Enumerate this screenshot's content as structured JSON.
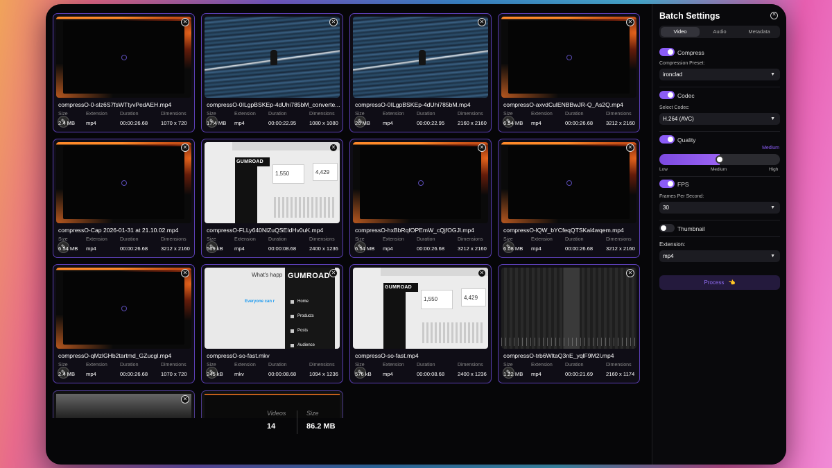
{
  "cards": [
    {
      "name": "compressO-0-slz6S7fsWTtyvPedAEH.mp4",
      "size": "2.4 MB",
      "ext": "mp4",
      "duration": "00:00:26.68",
      "dims": "1070 x 720",
      "thumb": "dark"
    },
    {
      "name": "compressO-0ILgpBSKEp-4dUhi785bM_converte...",
      "size": "17.4 MB",
      "ext": "mp4",
      "duration": "00:00:22.95",
      "dims": "1080 x 1080",
      "thumb": "sea"
    },
    {
      "name": "compressO-0ILgpBSKEp-4dUhi785bM.mp4",
      "size": "26 MB",
      "ext": "mp4",
      "duration": "00:00:22.95",
      "dims": "2160 x 2160",
      "thumb": "sea"
    },
    {
      "name": "compressO-axvdCulENBBwJR-Q_As2Q.mp4",
      "size": "6.54 MB",
      "ext": "mp4",
      "duration": "00:00:26.68",
      "dims": "3212 x 2160",
      "thumb": "dark"
    },
    {
      "name": "compressO-Cap 2026-01-31 at 21.10.02.mp4",
      "size": "6.54 MB",
      "ext": "mp4",
      "duration": "00:00:26.68",
      "dims": "3212 x 2160",
      "thumb": "dark"
    },
    {
      "name": "compressO-FLLy640NlZuQSEIdHv0uK.mp4",
      "size": "569 kB",
      "ext": "mp4",
      "duration": "00:00:08.68",
      "dims": "2400 x 1236",
      "thumb": "light"
    },
    {
      "name": "compressO-hxBbRqfOPEmW_cQjfOGJl.mp4",
      "size": "6.54 MB",
      "ext": "mp4",
      "duration": "00:00:26.68",
      "dims": "3212 x 2160",
      "thumb": "dark"
    },
    {
      "name": "compressO-lQW_bYCfeqQTSKal4wqem.mp4",
      "size": "6.08 MB",
      "ext": "mp4",
      "duration": "00:00:26.68",
      "dims": "3212 x 2160",
      "thumb": "dark"
    },
    {
      "name": "compressO-qMzlGHb2tartmd_GZucgl.mp4",
      "size": "2.4 MB",
      "ext": "mp4",
      "duration": "00:00:26.68",
      "dims": "1070 x 720",
      "thumb": "dark"
    },
    {
      "name": "compressO-so-fast.mkv",
      "size": "245 kB",
      "ext": "mkv",
      "duration": "00:00:08.68",
      "dims": "1094 x 1236",
      "thumb": "gum2"
    },
    {
      "name": "compressO-so-fast.mp4",
      "size": "576 kB",
      "ext": "mp4",
      "duration": "00:00:08.68",
      "dims": "2400 x 1236",
      "thumb": "light"
    },
    {
      "name": "compressO-trb6WltaQ3nE_yqlF9M2l.mp4",
      "size": "1.22 MB",
      "ext": "mp4",
      "duration": "00:00:21.69",
      "dims": "2160 x 1174",
      "thumb": "bars2"
    }
  ],
  "meta_labels": {
    "size": "Size",
    "extension": "Extension",
    "duration": "Duration",
    "dimensions": "Dimensions"
  },
  "thumb_text": {
    "gumroad": "GUMROAD",
    "stat1": "1,550",
    "stat2": "4,429",
    "whats": "What's happ",
    "everyone": "Everyone can r",
    "menu": [
      "Home",
      "Products",
      "Posts",
      "Audience"
    ]
  },
  "summary": {
    "videos_label": "Videos",
    "videos_value": "14",
    "size_label": "Size",
    "size_value": "86.2 MB"
  },
  "panel": {
    "title": "Batch Settings",
    "tabs": [
      "Video",
      "Audio",
      "Metadata"
    ],
    "active_tab": "Video",
    "compress_label": "Compress",
    "compress_on": true,
    "compression_preset_label": "Compression Preset:",
    "compression_preset": "ironclad",
    "codec_label": "Codec",
    "codec_on": true,
    "select_codec_label": "Select Codec:",
    "codec": "H.264 (AVC)",
    "quality_label": "Quality",
    "quality_on": true,
    "quality_value_label": "Medium",
    "quality_level": 0.5,
    "quality_ticks": [
      "Low",
      "Medium",
      "High"
    ],
    "fps_label": "FPS",
    "fps_on": true,
    "fps_field_label": "Frames Per Second:",
    "fps": "30",
    "thumbnail_label": "Thumbnail",
    "thumbnail_on": false,
    "extension_label": "Extension:",
    "extension": "mp4",
    "process_label": "Process",
    "process_icon": "hand-pointing-icon"
  },
  "colors": {
    "accent": "#8b5cf6",
    "card_border": "#5b3fb5",
    "bg": "#060608"
  }
}
